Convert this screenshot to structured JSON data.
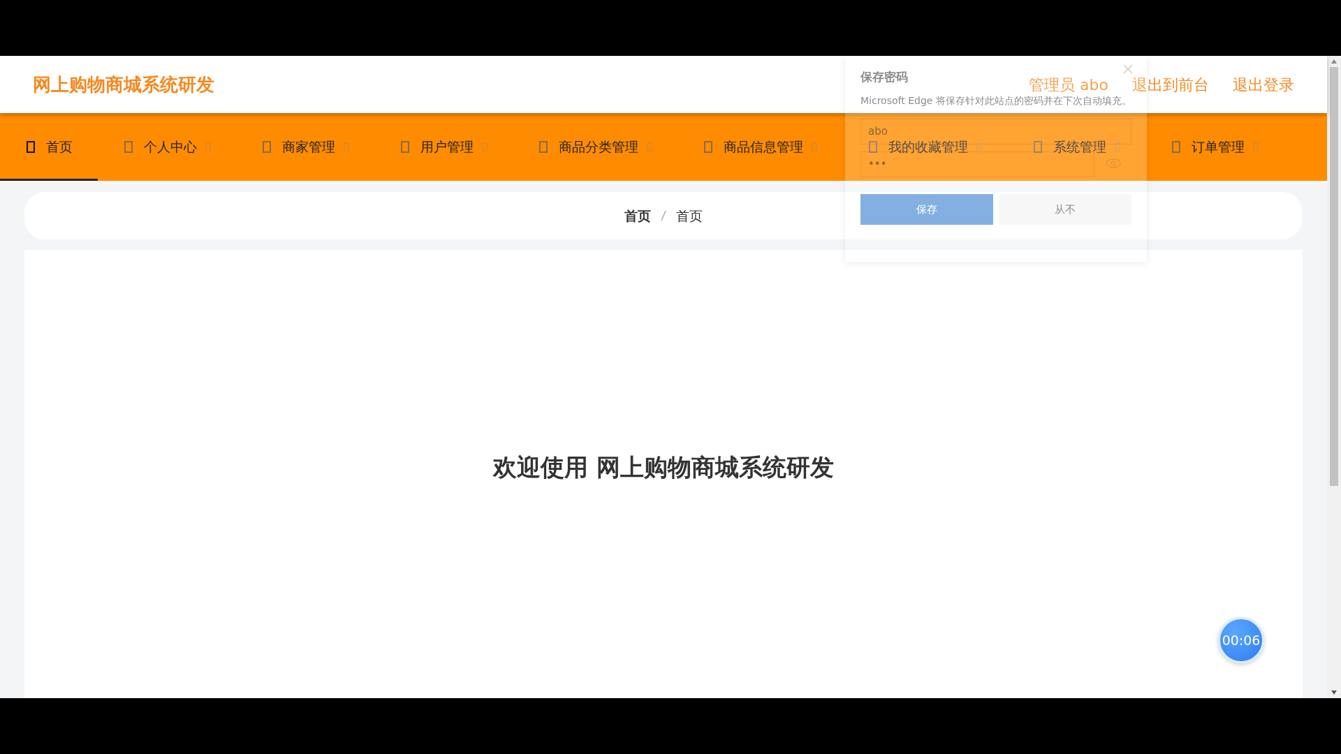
{
  "header": {
    "title": "网上购物商城系统研发",
    "links": [
      "管理员 abo",
      "退出到前台",
      "退出登录"
    ]
  },
  "nav": [
    {
      "label": "首页",
      "selected": true,
      "dropdown": false
    },
    {
      "label": "个人中心",
      "selected": false,
      "dropdown": true
    },
    {
      "label": "商家管理",
      "selected": false,
      "dropdown": true
    },
    {
      "label": "用户管理",
      "selected": false,
      "dropdown": true
    },
    {
      "label": "商品分类管理",
      "selected": false,
      "dropdown": true
    },
    {
      "label": "商品信息管理",
      "selected": false,
      "dropdown": true
    },
    {
      "label": "我的收藏管理",
      "selected": false,
      "dropdown": true
    },
    {
      "label": "系统管理",
      "selected": false,
      "dropdown": true
    },
    {
      "label": "订单管理",
      "selected": false,
      "dropdown": true
    }
  ],
  "breadcrumb": [
    "首页",
    "首页"
  ],
  "welcome": "欢迎使用 网上购物商城系统研发",
  "timer": "00:06",
  "password_popup": {
    "title": "保存密码",
    "message": "Microsoft Edge 将保存针对此站点的密码并在下次自动填充。",
    "username": "abo",
    "password": "•••",
    "save": "保存",
    "never": "从不"
  }
}
